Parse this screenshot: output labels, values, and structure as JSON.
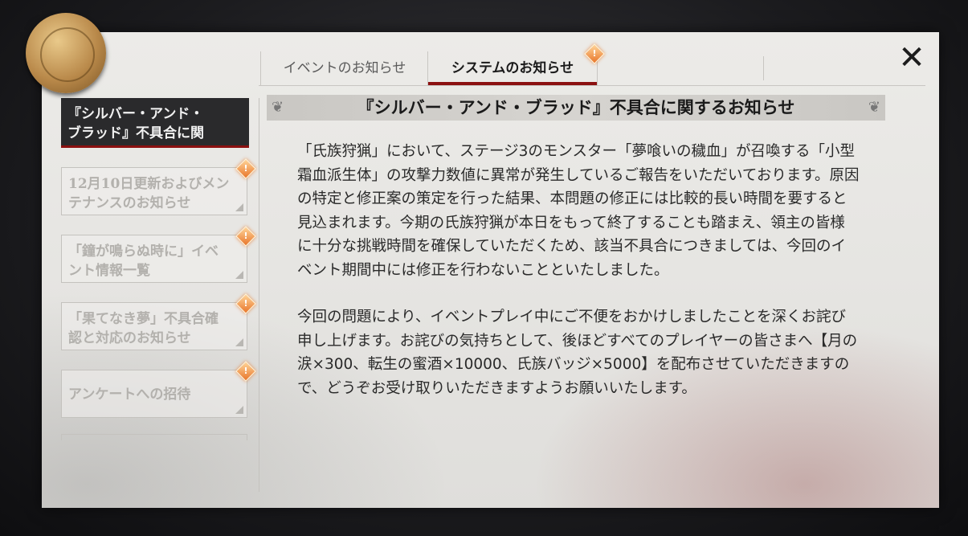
{
  "tabs": [
    {
      "label": "イベントのお知らせ",
      "active": false
    },
    {
      "label": "システムのお知らせ",
      "active": true,
      "badge": "!"
    }
  ],
  "close_icon": "close-x-icon",
  "sidebar": {
    "items": [
      {
        "label_line1": "『シルバー・アンド・",
        "label_line2": "ブラッド』不具合に関",
        "active": true
      },
      {
        "label_line1": "12月10日更新およびメン",
        "label_line2": "テナンスのお知らせ",
        "badge": "!"
      },
      {
        "label_line1": "「鐘が鳴らぬ時に」イベ",
        "label_line2": "ント情報一覧",
        "badge": "!"
      },
      {
        "label_line1": "「果てなき夢」不具合確",
        "label_line2": "認と対応のお知らせ",
        "badge": "!"
      },
      {
        "label_line1": "アンケートへの招待",
        "label_line2": "",
        "badge": "!"
      }
    ]
  },
  "article": {
    "title": "『シルバー・アンド・ブラッド』不具合に関するお知らせ",
    "paragraphs": [
      "「氏族狩猟」において、ステージ3のモンスター「夢喰いの穢血」が召喚する「小型霜血派生体」の攻撃力数値に異常が発生しているご報告をいただいております。原因の特定と修正案の策定を行った結果、本問題の修正には比較的長い時間を要すると見込まれます。今期の氏族狩猟が本日をもって終了することも踏まえ、領主の皆様に十分な挑戦時間を確保していただくため、該当不具合につきましては、今回のイベント期間中には修正を行わないことといたしました。",
      "今回の問題により、イベントプレイ中にご不便をおかけしましたことを深くお詫び申し上げます。お詫びの気持ちとして、後ほどすべてのプレイヤーの皆さまへ【月の涙×300、転生の蜜酒×10000、氏族バッジ×5000】を配布させていただきますので、どうぞお受け取りいただきますようお願いいたします。"
    ]
  },
  "colors": {
    "accent": "#8b1010",
    "badge": "#e8762b",
    "active_item_bg": "#2a2a2c"
  }
}
